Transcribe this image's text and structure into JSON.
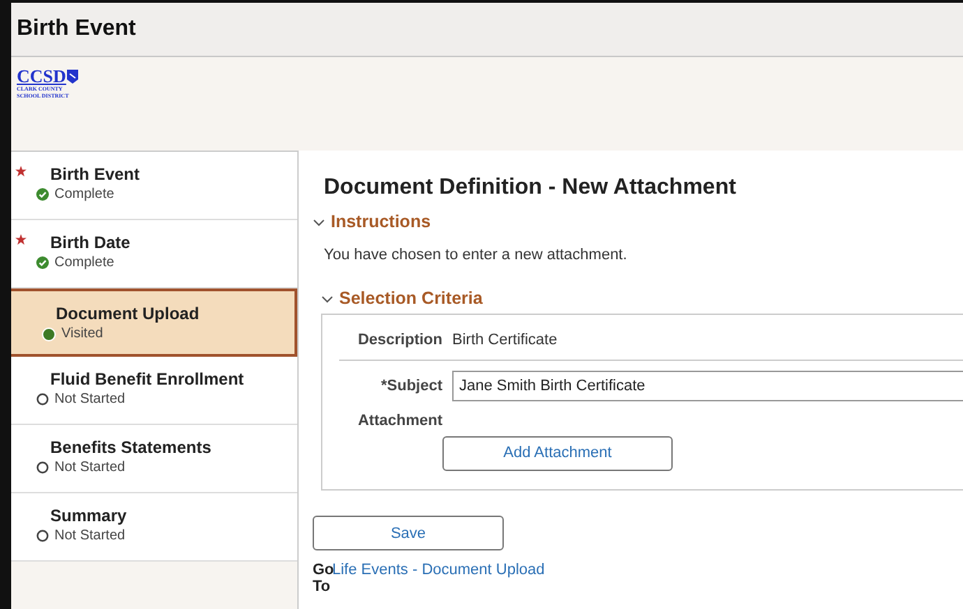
{
  "window": {
    "title": "Birth Event"
  },
  "logo": {
    "name": "CCSD",
    "line_1": "CLARK COUNTY",
    "line_2": "SCHOOL DISTRICT"
  },
  "steps": [
    {
      "title": "Birth Event",
      "status": "Complete",
      "kind": "complete",
      "required": true,
      "selected": false
    },
    {
      "title": "Birth Date",
      "status": "Complete",
      "kind": "complete",
      "required": true,
      "selected": false
    },
    {
      "title": "Document Upload",
      "status": "Visited",
      "kind": "visited",
      "required": false,
      "selected": true
    },
    {
      "title": "Fluid Benefit Enrollment",
      "status": "Not Started",
      "kind": "not_started",
      "required": false,
      "selected": false
    },
    {
      "title": "Benefits Statements",
      "status": "Not Started",
      "kind": "not_started",
      "required": false,
      "selected": false
    },
    {
      "title": "Summary",
      "status": "Not Started",
      "kind": "not_started",
      "required": false,
      "selected": false
    }
  ],
  "page_title": "Document Definition - New Attachment",
  "instructions": {
    "title": "Instructions",
    "expanded": true,
    "text": "You have chosen to enter a new attachment."
  },
  "selection_criteria": {
    "title": "Selection Criteria",
    "expanded": true,
    "description_label": "Description",
    "description_value": "Birth Certificate",
    "subject_label": "*Subject",
    "subject_value": "Jane Smith Birth Certificate",
    "attachment_label": "Attachment",
    "add_button": "Add Attachment"
  },
  "save_button": "Save",
  "go_to": {
    "label_1": "Go",
    "label_2": "To",
    "link": "Life Events - Document Upload"
  }
}
